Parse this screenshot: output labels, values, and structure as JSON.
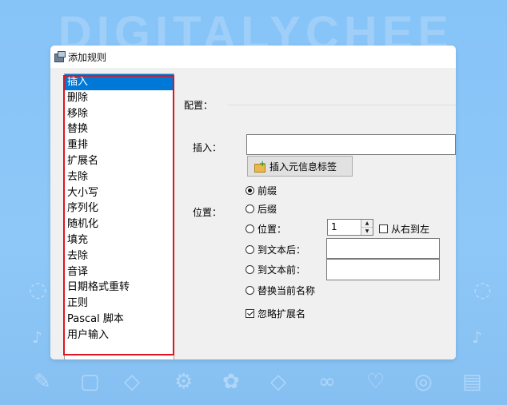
{
  "watermark": "DIGITALYCHEE",
  "window": {
    "title": "添加规则"
  },
  "rule_list": {
    "items": [
      "插入",
      "删除",
      "移除",
      "替换",
      "重排",
      "扩展名",
      "去除",
      "大小写",
      "序列化",
      "随机化",
      "填充",
      "去除",
      "音译",
      "日期格式重转",
      "正则",
      "Pascal 脚本",
      "用户输入"
    ],
    "selected_index": 0
  },
  "config": {
    "section_label": "配置：",
    "insert_label": "插入：",
    "insert_value": "",
    "insert_meta_button": "插入元信息标签",
    "position_label": "位置：",
    "options": {
      "prefix": "前缀",
      "suffix": "后缀",
      "position": "位置：",
      "after_text": "到文本后：",
      "before_text": "到文本前：",
      "replace_name": "替换当前名称"
    },
    "selected_option": "prefix",
    "position_value": "1",
    "right_to_left_label": "从右到左",
    "right_to_left_checked": false,
    "after_text_value": "",
    "before_text_value": "",
    "ignore_ext_label": "忽略扩展名",
    "ignore_ext_checked": true
  },
  "colors": {
    "selection": "#0078d7",
    "highlight_frame": "#e0141e",
    "background": "#8ec8f8"
  }
}
